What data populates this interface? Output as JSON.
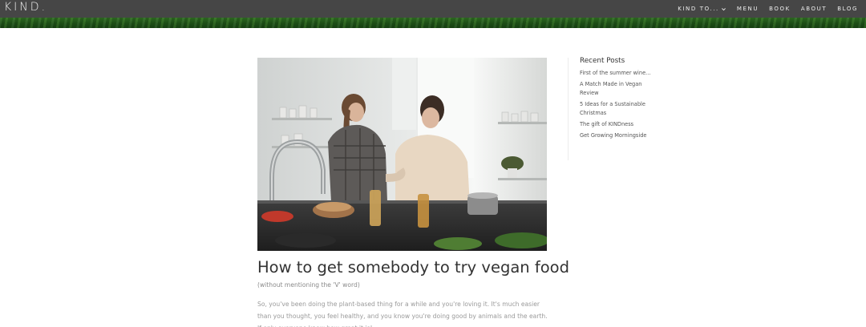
{
  "header": {
    "logo": "KIND.",
    "nav": [
      {
        "label": "KIND TO..."
      },
      {
        "label": "MENU"
      },
      {
        "label": "BOOK"
      },
      {
        "label": "ABOUT"
      },
      {
        "label": "BLOG"
      }
    ]
  },
  "post": {
    "image_alt": "Two women preparing food in a bright kitchen",
    "title": "How to get somebody to try vegan food",
    "subtitle": "(without mentioning the 'V' word)",
    "excerpt": "So, you've been doing the plant-based thing for a while and you're loving it. It's much easier than you thought, you feel healthy, and you know you're doing good by animals and the earth. If only everyone knew how great it is!"
  },
  "sidebar": {
    "heading": "Recent Posts",
    "items": [
      {
        "label": "First of the summer wine..."
      },
      {
        "label": "A Match Made in Vegan Review"
      },
      {
        "label": "5 Ideas for a Sustainable Christmas"
      },
      {
        "label": "The gift of KINDness"
      },
      {
        "label": "Get Growing Morningside"
      }
    ]
  },
  "colors": {
    "header_bg": "#464646",
    "banner_green": "#1f5418",
    "title_text": "#333333",
    "muted_text": "#9a9a9a"
  }
}
